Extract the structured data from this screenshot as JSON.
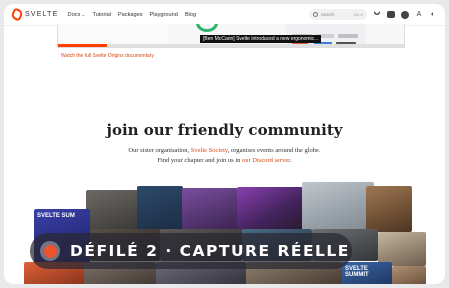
{
  "nav": {
    "logo_text": "SVELTE",
    "links": [
      "Docs",
      "Tutorial",
      "Packages",
      "Playground",
      "Blog"
    ],
    "search_placeholder": "Search",
    "search_shortcut": "Ctrl K",
    "icons": [
      "bluesky-icon",
      "discord-icon",
      "github-icon",
      "language-icon",
      "theme-toggle-icon"
    ]
  },
  "video": {
    "caption": "[Ben McCann] Svelte introduced a new ergonomic...",
    "watch_link": "Watch the full Svelte Origins documentary",
    "progress": 0.14
  },
  "community": {
    "heading": "join our friendly community",
    "line1_pre": "Our sister organisation, ",
    "line1_link": "Svelte Society",
    "line1_post": ", organises events around the globe.",
    "line2_pre": "Find your chapter and join us in ",
    "line2_link": "our Discord server",
    "line2_post": "."
  },
  "collage": {
    "poster_text_1": "SVELTE SUM",
    "poster_text_2": "SVELTE SUMMIT"
  },
  "overlay": {
    "label": "DÉFILÉ 2 · CAPTURE RÉELLE",
    "accent": "#f0522d"
  },
  "colors": {
    "brand": "#ff3e00",
    "link": "#d9480f"
  }
}
